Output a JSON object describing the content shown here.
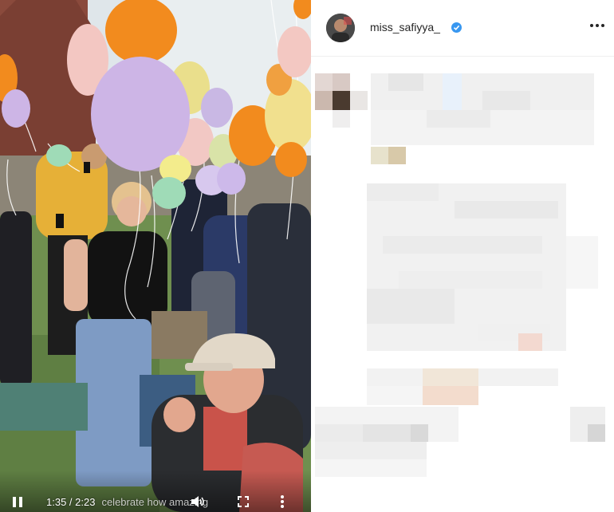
{
  "video": {
    "time": "1:35 / 2:23",
    "caption": "celebrate how amazing",
    "controls": {
      "play_pause": "pause-icon",
      "volume": "speaker-icon",
      "fullscreen": "fullscreen-icon",
      "more": "more-vertical-icon"
    }
  },
  "post": {
    "username": "miss_safiyya_",
    "verified": true,
    "options_icon": "more-horizontal-icon",
    "comments_obscured": true
  },
  "colors": {
    "accent_verified": "#3897f0",
    "text": "#262626"
  }
}
